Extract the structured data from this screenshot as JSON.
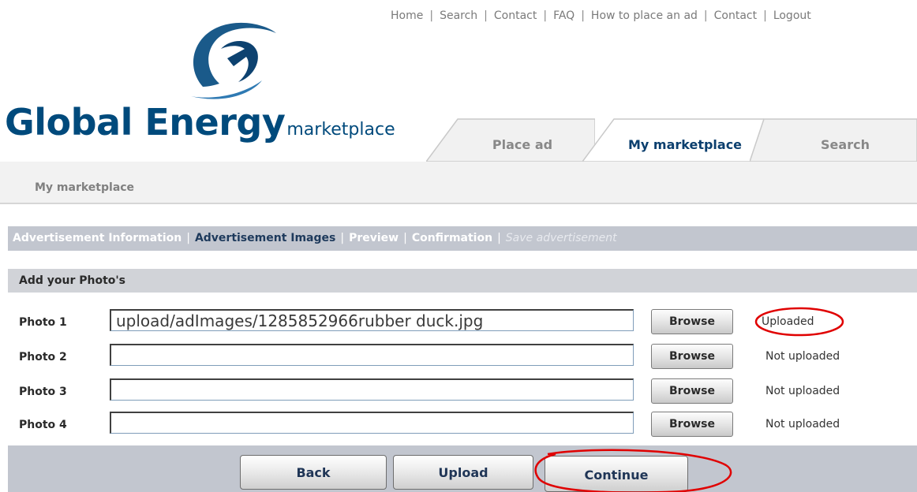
{
  "top_nav": {
    "links": [
      "Home",
      "Search",
      "Contact",
      "FAQ",
      "How to place an ad",
      "Contact",
      "Logout"
    ],
    "separator": "|"
  },
  "logo": {
    "word": "Global Energy",
    "sub": "marketplace",
    "brand_color": "#004a7c"
  },
  "tabs": [
    {
      "label": "Place ad",
      "active": false
    },
    {
      "label": "My marketplace",
      "active": true
    },
    {
      "label": "Search",
      "active": false
    }
  ],
  "section_title": "My marketplace",
  "steps": {
    "separator": "|",
    "items": [
      {
        "label": "Advertisement Information",
        "state": "done"
      },
      {
        "label": "Advertisement Images",
        "state": "current"
      },
      {
        "label": "Preview",
        "state": "pending"
      },
      {
        "label": "Confirmation",
        "state": "pending"
      },
      {
        "label": "Save advertisement",
        "state": "disabled"
      }
    ]
  },
  "photos_header": "Add your Photo's",
  "photos": [
    {
      "label": "Photo 1",
      "value": "upload/adImages/1285852966rubber duck.jpg",
      "browse_label": "Browse",
      "status": "Uploaded"
    },
    {
      "label": "Photo 2",
      "value": "",
      "browse_label": "Browse",
      "status": "Not uploaded"
    },
    {
      "label": "Photo 3",
      "value": "",
      "browse_label": "Browse",
      "status": "Not uploaded"
    },
    {
      "label": "Photo 4",
      "value": "",
      "browse_label": "Browse",
      "status": "Not uploaded"
    }
  ],
  "buttons": {
    "back": "Back",
    "upload": "Upload",
    "continue": "Continue"
  },
  "colors": {
    "accent": "#004a7c",
    "steps_bar": "#c2c6cf",
    "annotation": "#e00000"
  }
}
